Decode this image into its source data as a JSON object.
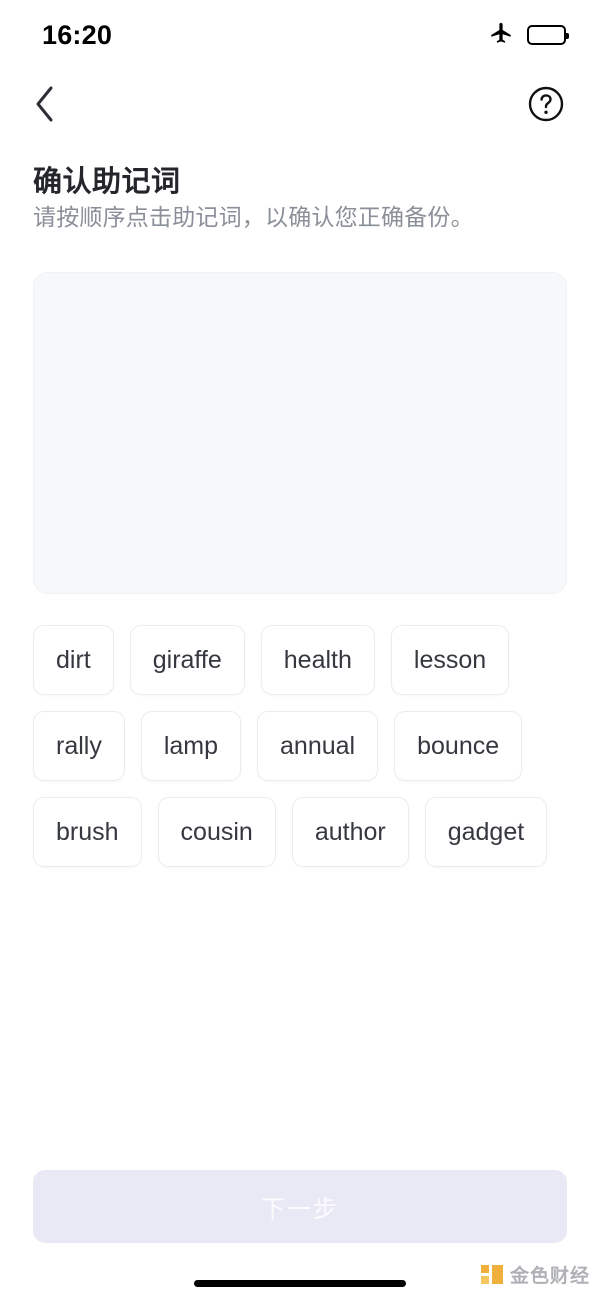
{
  "status_bar": {
    "time": "16:20",
    "airplane_icon": "airplane-mode-icon",
    "battery_icon": "battery-low-power-icon",
    "battery_level_percent": 45,
    "battery_color": "#ffcc00"
  },
  "nav": {
    "back_icon": "chevron-left-icon",
    "help_icon": "question-mark-circle-icon"
  },
  "header": {
    "title": "确认助记词",
    "subtitle": "请按顺序点击助记词，以确认您正确备份。"
  },
  "answer_box": {
    "selected_words": [],
    "background_color": "#f7f8fa"
  },
  "word_pool": {
    "words": [
      "dirt",
      "giraffe",
      "health",
      "lesson",
      "rally",
      "lamp",
      "annual",
      "bounce",
      "brush",
      "cousin",
      "author",
      "gadget"
    ]
  },
  "footer": {
    "next_button_label": "下一步",
    "next_button_enabled": false,
    "next_button_color": "#e9e9f6"
  },
  "watermark": {
    "text": "金色财经",
    "logo_color": "#f0a92b"
  }
}
